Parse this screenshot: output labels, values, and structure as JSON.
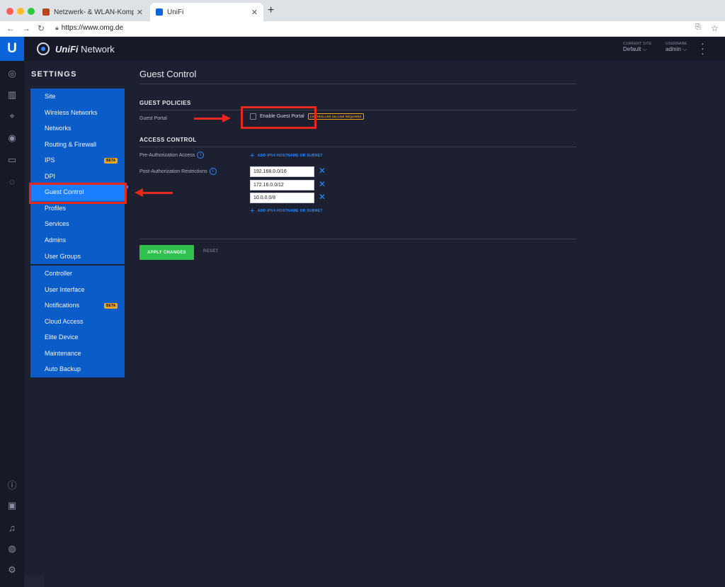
{
  "browser": {
    "tabs": [
      {
        "title": "Netzwerk- & WLAN-Komponen",
        "active": false
      },
      {
        "title": "UniFi",
        "active": true
      }
    ],
    "url": "https://www.omg.de"
  },
  "header": {
    "brand_italic": "UniFi",
    "brand_rest": " Network",
    "current_site_label": "CURRENT SITE",
    "current_site_value": "Default",
    "username_label": "USERNAME",
    "username_value": "admin"
  },
  "settings": {
    "title": "SETTINGS",
    "group1": [
      "Site",
      "Wireless Networks",
      "Networks",
      "Routing & Firewall",
      "IPS",
      "DPI",
      "Guest Control",
      "Profiles",
      "Services",
      "Admins",
      "User Groups"
    ],
    "group2": [
      "Controller",
      "User Interface",
      "Notifications",
      "Cloud Access",
      "Elite Device",
      "Maintenance",
      "Auto Backup"
    ],
    "active_item": "Guest Control",
    "beta_label": "BETA"
  },
  "main": {
    "title": "Guest Control",
    "guest_policies": {
      "heading": "GUEST POLICIES",
      "guest_portal_label": "Guest Portal",
      "enable_label": "Enable Guest Portal",
      "enable_checked": false,
      "requirement_badge": "CONTROLLER ON-LINE REQUIRED"
    },
    "access_control": {
      "heading": "ACCESS CONTROL",
      "pre_auth_label": "Pre-Authorization Access",
      "post_auth_label": "Post-Authorization Restrictions",
      "add_link": "ADD IPV4 HOSTNAME OR SUBNET",
      "post_auth_entries": [
        "192.168.0.0/16",
        "172.16.0.0/12",
        "10.0.0.0/8"
      ]
    },
    "apply_label": "APPLY CHANGES",
    "reset_label": "RESET"
  },
  "colors": {
    "accent": "#0a5cc8",
    "active_item": "#1a7eff",
    "apply": "#2fc04d",
    "annotation": "#e8281d",
    "badge": "#f2a51c"
  }
}
